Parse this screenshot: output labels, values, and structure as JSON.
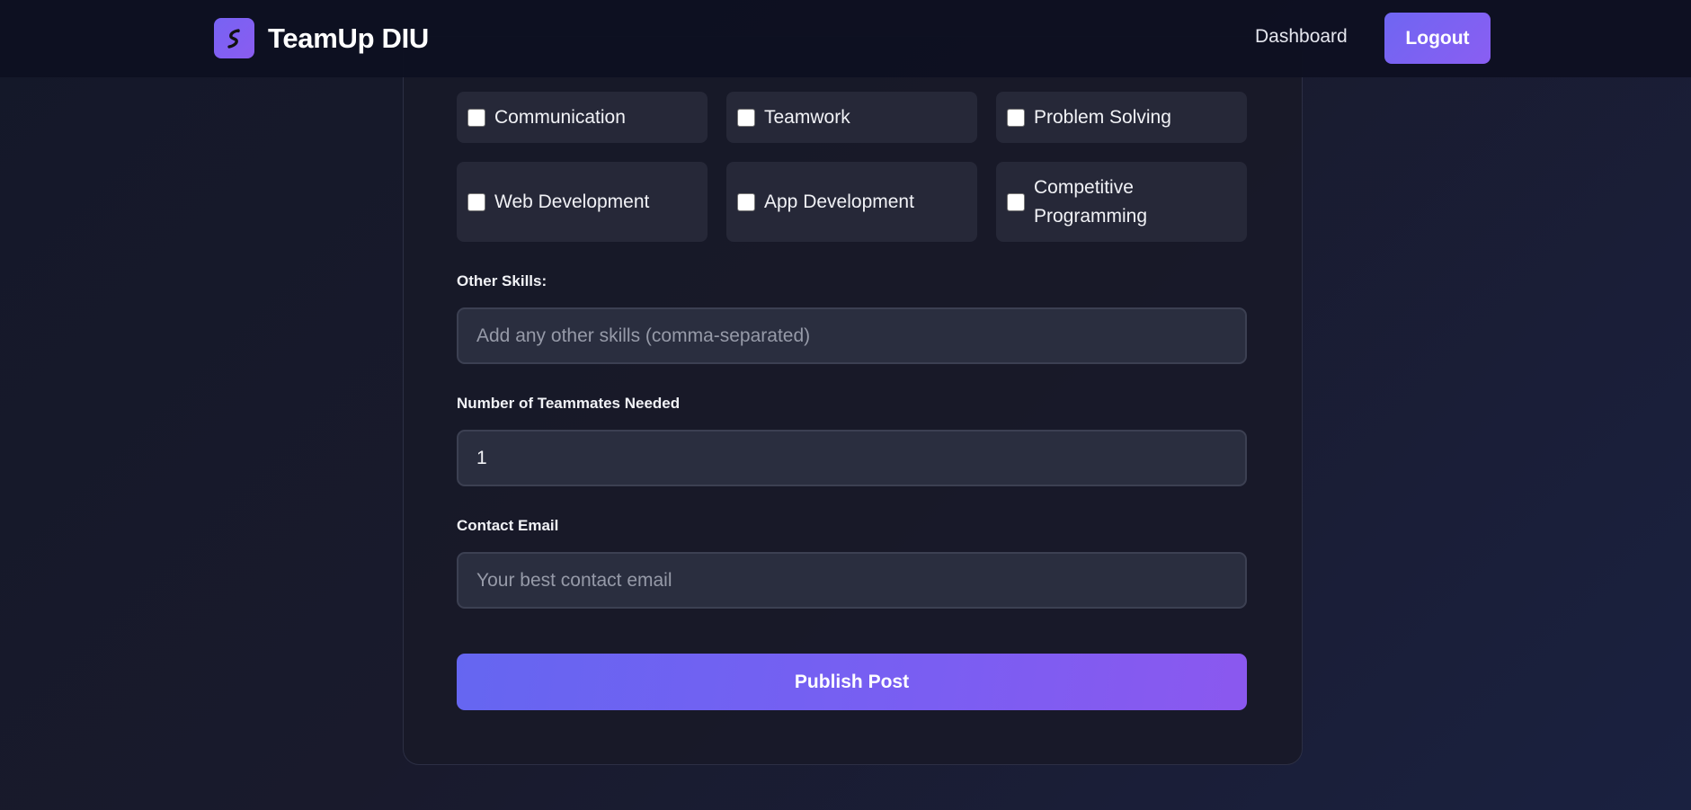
{
  "header": {
    "brand_name": "TeamUp DIU",
    "brand_icon": "rocket-icon",
    "nav_link": "Dashboard",
    "logout_label": "Logout"
  },
  "skills": [
    {
      "label": "Communication",
      "checked": false
    },
    {
      "label": "Teamwork",
      "checked": false
    },
    {
      "label": "Problem Solving",
      "checked": false
    },
    {
      "label": "Web Development",
      "checked": false
    },
    {
      "label": "App Development",
      "checked": false
    },
    {
      "label": "Competitive Programming",
      "checked": false
    }
  ],
  "other_skills": {
    "label": "Other Skills:",
    "placeholder": "Add any other skills (comma-separated)",
    "value": ""
  },
  "teammates_needed": {
    "label": "Number of Teammates Needed",
    "value": "1"
  },
  "contact_email": {
    "label": "Contact Email",
    "placeholder": "Your best contact email",
    "value": ""
  },
  "publish_label": "Publish Post",
  "colors": {
    "accent": "#6f66f2",
    "accent_end": "#8b58ef",
    "background": "#161a2c",
    "card": "#181928",
    "field": "#2a2e3f"
  }
}
